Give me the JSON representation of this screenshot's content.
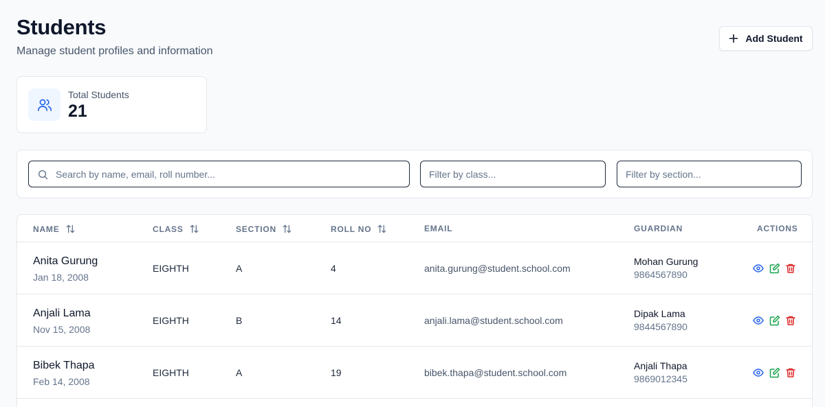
{
  "header": {
    "title": "Students",
    "subtitle": "Manage student profiles and information",
    "add_button_label": "Add Student"
  },
  "stats": {
    "total_label": "Total Students",
    "total_value": "21"
  },
  "filters": {
    "search_placeholder": "Search by name, email, roll number...",
    "class_placeholder": "Filter by class...",
    "section_placeholder": "Filter by section..."
  },
  "table": {
    "columns": {
      "name": "NAME",
      "class": "CLASS",
      "section": "SECTION",
      "roll": "ROLL NO",
      "email": "EMAIL",
      "guardian": "GUARDIAN",
      "actions": "ACTIONS"
    },
    "rows": [
      {
        "name": "Anita Gurung",
        "dob": "Jan 18, 2008",
        "class": "EIGHTH",
        "section": "A",
        "roll": "4",
        "email": "anita.gurung@student.school.com",
        "guardian_name": "Mohan Gurung",
        "guardian_phone": "9864567890"
      },
      {
        "name": "Anjali Lama",
        "dob": "Nov 15, 2008",
        "class": "EIGHTH",
        "section": "B",
        "roll": "14",
        "email": "anjali.lama@student.school.com",
        "guardian_name": "Dipak Lama",
        "guardian_phone": "9844567890"
      },
      {
        "name": "Bibek Thapa",
        "dob": "Feb 14, 2008",
        "class": "EIGHTH",
        "section": "A",
        "roll": "19",
        "email": "bibek.thapa@student.school.com",
        "guardian_name": "Anjali Thapa",
        "guardian_phone": "9869012345"
      }
    ]
  },
  "colors": {
    "accent_blue": "#2563eb",
    "edit_green": "#16a34a",
    "delete_red": "#dc2626"
  },
  "icons": {
    "add": "plus-icon",
    "stat": "users-icon",
    "search": "search-icon",
    "sort": "sort-arrows-icon",
    "view": "eye-icon",
    "edit": "edit-icon",
    "delete": "trash-icon"
  }
}
